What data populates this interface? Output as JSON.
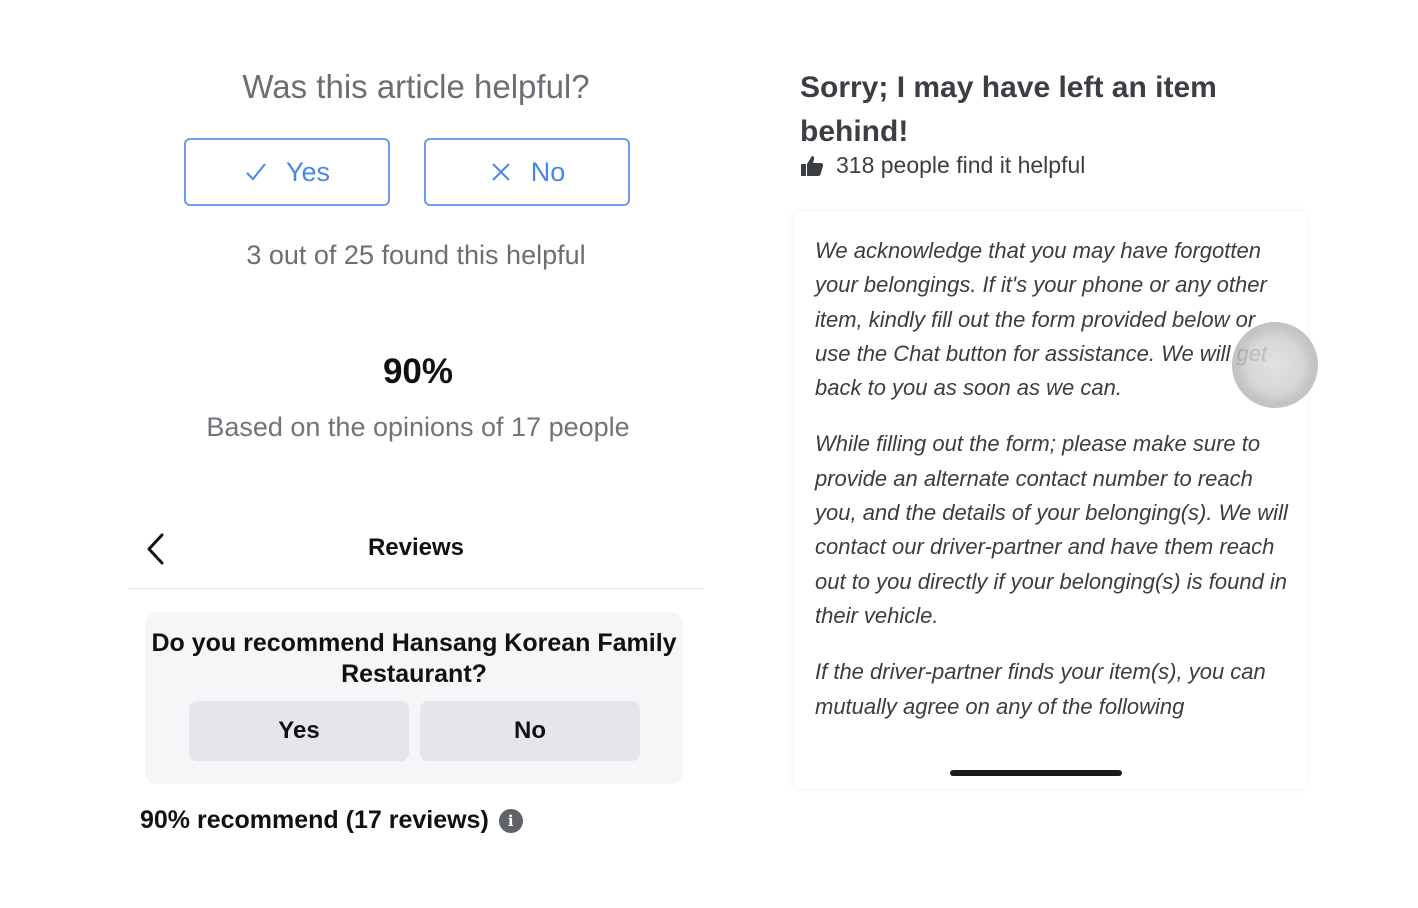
{
  "article_feedback": {
    "question": "Was this article helpful?",
    "yes_label": "Yes",
    "no_label": "No",
    "found_text": "3 out of 25 found this helpful",
    "percent": "90%",
    "based_on": "Based on the opinions of 17 people",
    "icons": {
      "yes": "checkmark-icon",
      "no": "x-icon"
    },
    "accent_color": "#4a86e8"
  },
  "reviews": {
    "title": "Reviews",
    "question": "Do you recommend Hansang Korean Family Restaurant?",
    "yes_label": "Yes",
    "no_label": "No",
    "summary": "90% recommend (17 reviews)",
    "info_glyph": "i",
    "icons": {
      "back": "chevron-left-icon",
      "info": "info-icon"
    }
  },
  "help_article": {
    "title": "Sorry; I may have left an item behind!",
    "helpful_count": "318 people find it helpful",
    "icons": {
      "helpful": "thumbs-up-icon"
    },
    "paragraphs": [
      "We acknowledge that you may have forgotten your belongings. If it's your phone or any other item, kindly fill out the form provided below or use the Chat button for assistance. We will get back to you as soon as we can.",
      "While filling out the form; please make sure to provide an alternate contact number to reach you, and the details of your belonging(s). We will contact our driver-partner and have them reach out to you directly if your belonging(s) is found in their vehicle.",
      "If the driver-partner finds your item(s), you can mutually agree on any of the following"
    ]
  }
}
